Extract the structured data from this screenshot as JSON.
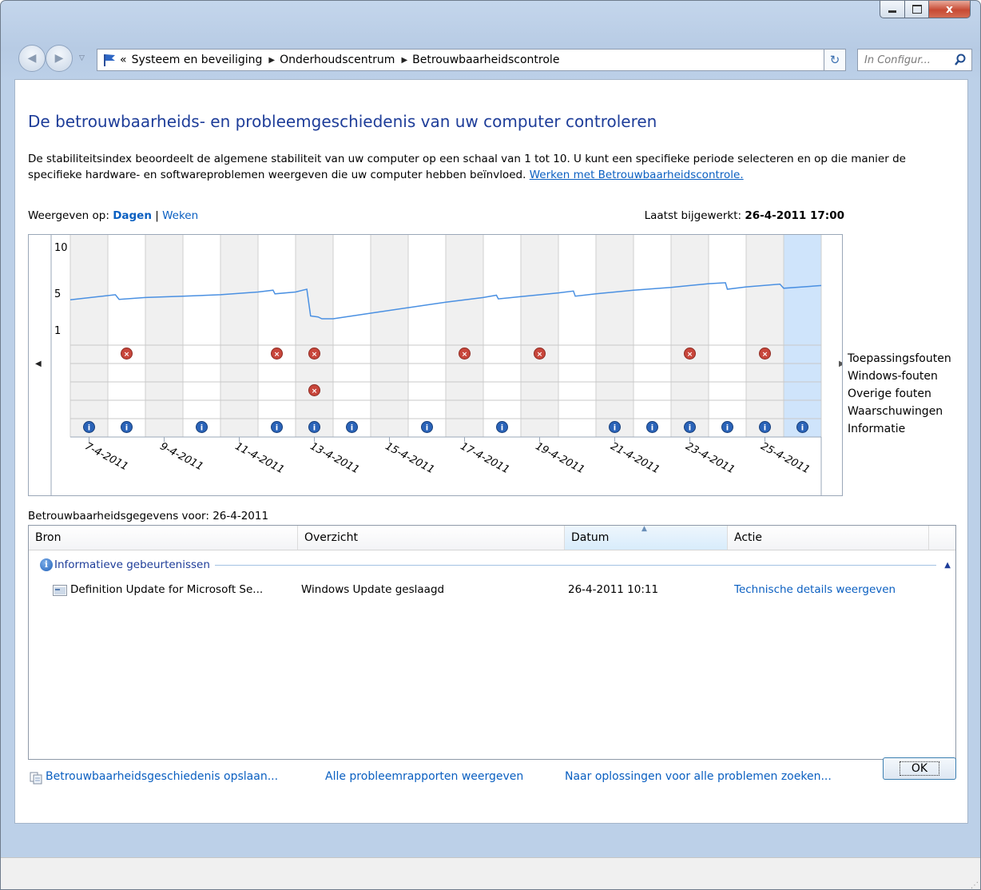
{
  "window": {
    "close_glyph": "x"
  },
  "navigation": {
    "breadcrumb_prefix": "«",
    "breadcrumbs": [
      "Systeem en beveiliging",
      "Onderhoudscentrum",
      "Betrouwbaarheidscontrole"
    ],
    "search_placeholder": "In Configur..."
  },
  "page": {
    "title": "De betrouwbaarheids- en probleemgeschiedenis van uw computer controleren",
    "description": "De stabiliteitsindex beoordeelt de algemene stabiliteit van uw computer op een schaal van 1 tot 10. U kunt een specifieke periode selecteren en op die manier de specifieke hardware- en softwareproblemen weergeven die uw computer hebben beïnvloed.",
    "description_link": "Werken met Betrouwbaarheidscontrole.",
    "view_label": "Weergeven op:",
    "view_days": "Dagen",
    "view_separator": "|",
    "view_weeks": "Weken",
    "last_updated_label": "Laatst bijgewerkt:",
    "last_updated_value": "26-4-2011 17:00"
  },
  "chart_data": {
    "type": "line",
    "title": "",
    "y_ticks": [
      "10",
      "5",
      "1"
    ],
    "ylim": [
      1,
      10
    ],
    "days": 20,
    "x_date_labels": [
      "7-4-2011",
      "9-4-2011",
      "11-4-2011",
      "13-4-2011",
      "15-4-2011",
      "17-4-2011",
      "19-4-2011",
      "21-4-2011",
      "23-4-2011",
      "25-4-2011"
    ],
    "stability_index": [
      [
        0,
        4.35
      ],
      [
        1.2,
        4.9
      ],
      [
        1.3,
        4.4
      ],
      [
        2,
        4.6
      ],
      [
        3,
        4.75
      ],
      [
        4,
        4.9
      ],
      [
        5,
        5.2
      ],
      [
        5.4,
        5.4
      ],
      [
        5.45,
        5.0
      ],
      [
        6,
        5.2
      ],
      [
        6.3,
        5.5
      ],
      [
        6.4,
        2.6
      ],
      [
        6.6,
        2.5
      ],
      [
        6.7,
        2.3
      ],
      [
        7,
        2.3
      ],
      [
        8,
        2.9
      ],
      [
        9,
        3.5
      ],
      [
        10,
        4.1
      ],
      [
        11,
        4.6
      ],
      [
        11.35,
        4.85
      ],
      [
        11.4,
        4.45
      ],
      [
        12,
        4.7
      ],
      [
        13,
        5.1
      ],
      [
        13.4,
        5.3
      ],
      [
        13.45,
        4.75
      ],
      [
        14,
        5.0
      ],
      [
        15,
        5.4
      ],
      [
        16,
        5.7
      ],
      [
        16.5,
        5.9
      ],
      [
        17,
        6.1
      ],
      [
        17.45,
        6.2
      ],
      [
        17.5,
        5.5
      ],
      [
        18,
        5.75
      ],
      [
        18.9,
        6.05
      ],
      [
        19,
        5.6
      ],
      [
        20,
        5.9
      ]
    ],
    "selected_day": 19,
    "rows": [
      "Toepassingsfouten",
      "Windows-fouten",
      "Overige fouten",
      "Waarschuwingen",
      "Informatie"
    ],
    "application_errors_days": [
      1,
      5,
      6,
      10,
      12,
      16,
      18
    ],
    "other_errors_days": [
      6
    ],
    "information_days": [
      0,
      1,
      3,
      5,
      6,
      7,
      9,
      11,
      14,
      15,
      16,
      17,
      18,
      19
    ]
  },
  "details": {
    "label": "Betrouwbaarheidsgegevens voor: 26-4-2011",
    "columns": [
      "Bron",
      "Overzicht",
      "Datum",
      "Actie"
    ],
    "group_title": "Informatieve gebeurtenissen",
    "rows": [
      {
        "source": "Definition Update for Microsoft Se...",
        "summary": "Windows Update geslaagd",
        "date": "26-4-2011 10:11",
        "action": "Technische details weergeven"
      }
    ]
  },
  "footer": {
    "save_history": "Betrouwbaarheidsgeschiedenis opslaan...",
    "all_reports": "Alle probleemrapporten weergeven",
    "find_solutions": "Naar oplossingen voor alle problemen zoeken...",
    "ok": "OK"
  },
  "colors": {
    "title": "#1e3d99",
    "link": "#0a5fc1",
    "line": "#4a90e2",
    "selected": "#cfe4fb"
  }
}
